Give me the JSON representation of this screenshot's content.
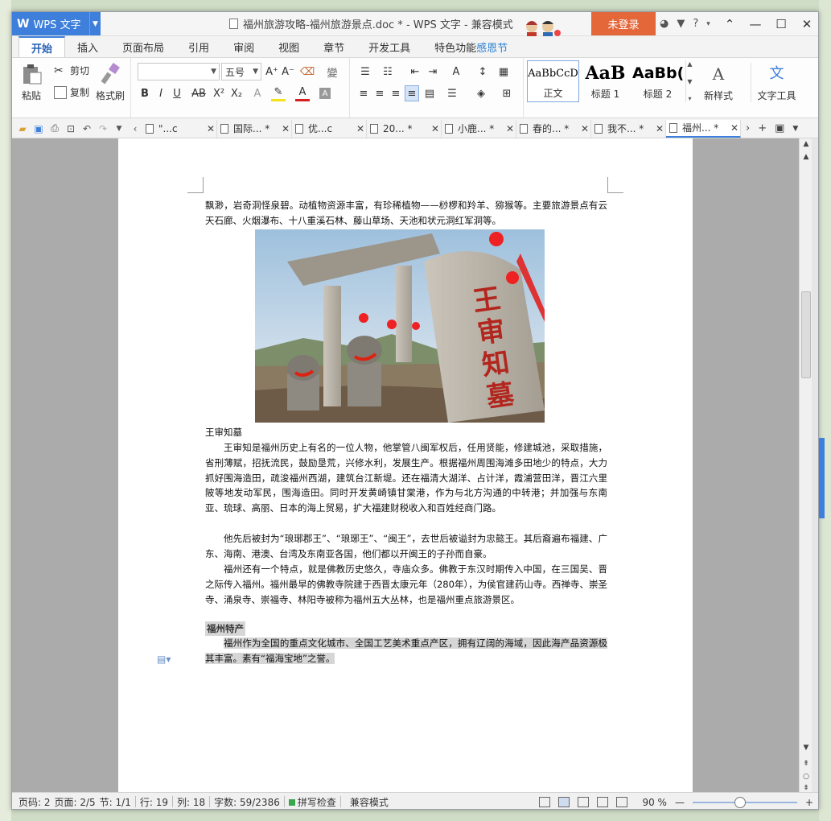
{
  "app": {
    "name": "WPS 文字",
    "login_label": "未登录",
    "title_text": "福州旅游攻略-福州旅游景点.doc * - WPS 文字 - 兼容模式"
  },
  "menu_tabs": [
    "开始",
    "插入",
    "页面布局",
    "引用",
    "审阅",
    "视图",
    "章节",
    "开发工具",
    "特色功能",
    "感恩节"
  ],
  "ribbon": {
    "paste": "粘贴",
    "cut": "剪切",
    "copy": "复制",
    "format_painter": "格式刷",
    "font_name": "",
    "font_size": "五号",
    "styles": [
      {
        "preview": "AaBbCcD",
        "name": "正文"
      },
      {
        "preview": "AaB",
        "name": "标题 1"
      },
      {
        "preview": "AaBb(",
        "name": "标题 2"
      }
    ],
    "new_style": "新样式",
    "text_tools": "文字工具"
  },
  "doc_tabs": [
    {
      "name": "\"...c"
    },
    {
      "name": "国际... *"
    },
    {
      "name": "优...c"
    },
    {
      "name": "20... *"
    },
    {
      "name": "小鹿... *"
    },
    {
      "name": "春的... *"
    },
    {
      "name": "我不... *"
    },
    {
      "name": "福州... *",
      "active": true
    }
  ],
  "document": {
    "para_top": "飘渺，岩奇洞怪泉碧。动植物资源丰富，有珍稀植物——桫椤和羚羊、猕猴等。主要旅游景点有云天石廊、火烟瀑布、十八重溪石林、藤山草场、天池和状元洞红军洞等。",
    "stele_text": "王审知墓",
    "caption": "王审知墓",
    "para1": "王审知是福州历史上有名的一位人物，他掌管八闽军权后，任用贤能，修建城池，采取措施，省刑薄赋，招抚流民，鼓励垦荒，兴修水利，发展生产。根据福州周围海滩多田地少的特点，大力抓好围海造田，疏浚福州西湖，建筑台江新堤。还在福清大湖洋、占计洋，霞浦营田洋，晋江六里陂等地发动军民，围海造田。同时开发黄崎镇甘棠港，作为与北方沟通的中转港；并加强与东南亚、琉球、高丽、日本的海上贸易，扩大福建财税收入和百姓经商门路。",
    "para2": "他先后被封为“琅琊郡王”、“琅琊王”、“闽王”，去世后被谥封为忠懿王。其后裔遍布福建、广东、海南、港澳、台湾及东南亚各国，他们都以开闽王的子孙而自豪。",
    "para3": "福州还有一个特点，就是佛教历史悠久，寺庙众多。佛教于东汉时期传入中国，在三国吴、晋之际传入福州。福州最早的佛教寺院建于西晋太康元年（280年），为侯官建药山寺。西禅寺、崇圣寺、涌泉寺、崇福寺、林阳寺被称为福州五大丛林，也是福州重点旅游景区。",
    "heading": "福州特产",
    "para4": "福州作为全国的重点文化城市、全国工艺美术重点产区，拥有辽阔的海域，因此海产品资源极其丰富。素有“福海宝地”之誉。"
  },
  "status": {
    "page_num": "页码: 2",
    "pages": "页面: 2/5",
    "section": "节: 1/1",
    "line": "行: 19",
    "col": "列: 18",
    "words": "字数: 59/2386",
    "spell": "拼写检查",
    "mode": "兼容模式",
    "zoom": "90 %"
  },
  "zoom_level": 0.45,
  "colors": {
    "accent": "#3d7fdb",
    "login": "#e4673a"
  }
}
